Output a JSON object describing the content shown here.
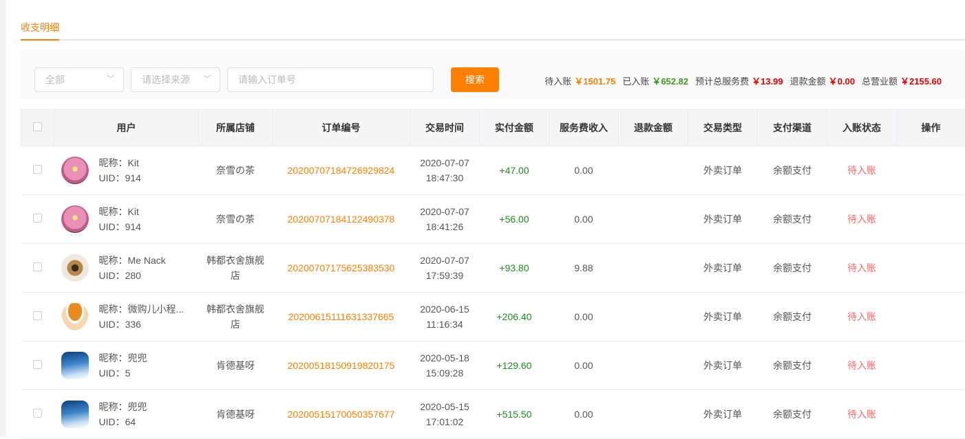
{
  "tab": "收支明细",
  "filters": {
    "type_value": "全部",
    "source_placeholder": "请选择来源",
    "order_placeholder": "请输入订单号",
    "search_label": "搜索"
  },
  "summary": [
    {
      "label": "待入账",
      "value": "￥1501.75",
      "color": "#ff7f00"
    },
    {
      "label": "已入账",
      "value": "￥652.82",
      "color": "#3c9a1e"
    },
    {
      "label": "预计总服务费",
      "value": "￥13.99",
      "color": "#f00000"
    },
    {
      "label": "退款金额",
      "value": "￥0.00",
      "color": "#f00000"
    },
    {
      "label": "总营业额",
      "value": "￥2155.60",
      "color": "#f00000"
    }
  ],
  "columns": [
    "用户",
    "所属店铺",
    "订单编号",
    "交易时间",
    "实付金额",
    "服务费收入",
    "退款金额",
    "交易类型",
    "支付渠道",
    "入账状态",
    "操作"
  ],
  "rows": [
    {
      "nick": "昵称：Kit",
      "uid": "UID：914",
      "store": "奈雪の茶",
      "order": "20200707184726929824",
      "date": "2020-07-07",
      "time": "18:47:30",
      "paid": "+47.00",
      "fee": "0.00",
      "refund": "",
      "type": "外卖订单",
      "channel": "余额支付",
      "status": "待入账",
      "avatar": "flower"
    },
    {
      "nick": "昵称：Kit",
      "uid": "UID：914",
      "store": "奈雪の茶",
      "order": "20200707184122490378",
      "date": "2020-07-07",
      "time": "18:41:26",
      "paid": "+56.00",
      "fee": "0.00",
      "refund": "",
      "type": "外卖订单",
      "channel": "余额支付",
      "status": "待入账",
      "avatar": "flower"
    },
    {
      "nick": "昵称：Me Nack",
      "uid": "UID：280",
      "store": "韩都衣舍旗舰店",
      "order": "20200707175625383530",
      "date": "2020-07-07",
      "time": "17:59:39",
      "paid": "+93.80",
      "fee": "9.88",
      "refund": "",
      "type": "外卖订单",
      "channel": "余额支付",
      "status": "待入账",
      "avatar": "sketch"
    },
    {
      "nick": "昵称：微购儿小程...",
      "uid": "UID：336",
      "store": "韩都衣舍旗舰店",
      "order": "20200615111631337665",
      "date": "2020-06-15",
      "time": "11:16:34",
      "paid": "+206.40",
      "fee": "0.00",
      "refund": "",
      "type": "外卖订单",
      "channel": "余额支付",
      "status": "待入账",
      "avatar": "hat"
    },
    {
      "nick": "昵称：兜兜",
      "uid": "UID：5",
      "store": "肯德基呀",
      "order": "20200518150919820175",
      "date": "2020-05-18",
      "time": "15:09:28",
      "paid": "+129.60",
      "fee": "0.00",
      "refund": "",
      "type": "外卖订单",
      "channel": "余额支付",
      "status": "待入账",
      "avatar": "sky"
    },
    {
      "nick": "昵称：兜兜",
      "uid": "UID：64",
      "store": "肯德基呀",
      "order": "20200515170050357677",
      "date": "2020-05-15",
      "time": "17:01:02",
      "paid": "+515.50",
      "fee": "0.00",
      "refund": "",
      "type": "外卖订单",
      "channel": "余额支付",
      "status": "待入账",
      "avatar": "sky"
    }
  ]
}
